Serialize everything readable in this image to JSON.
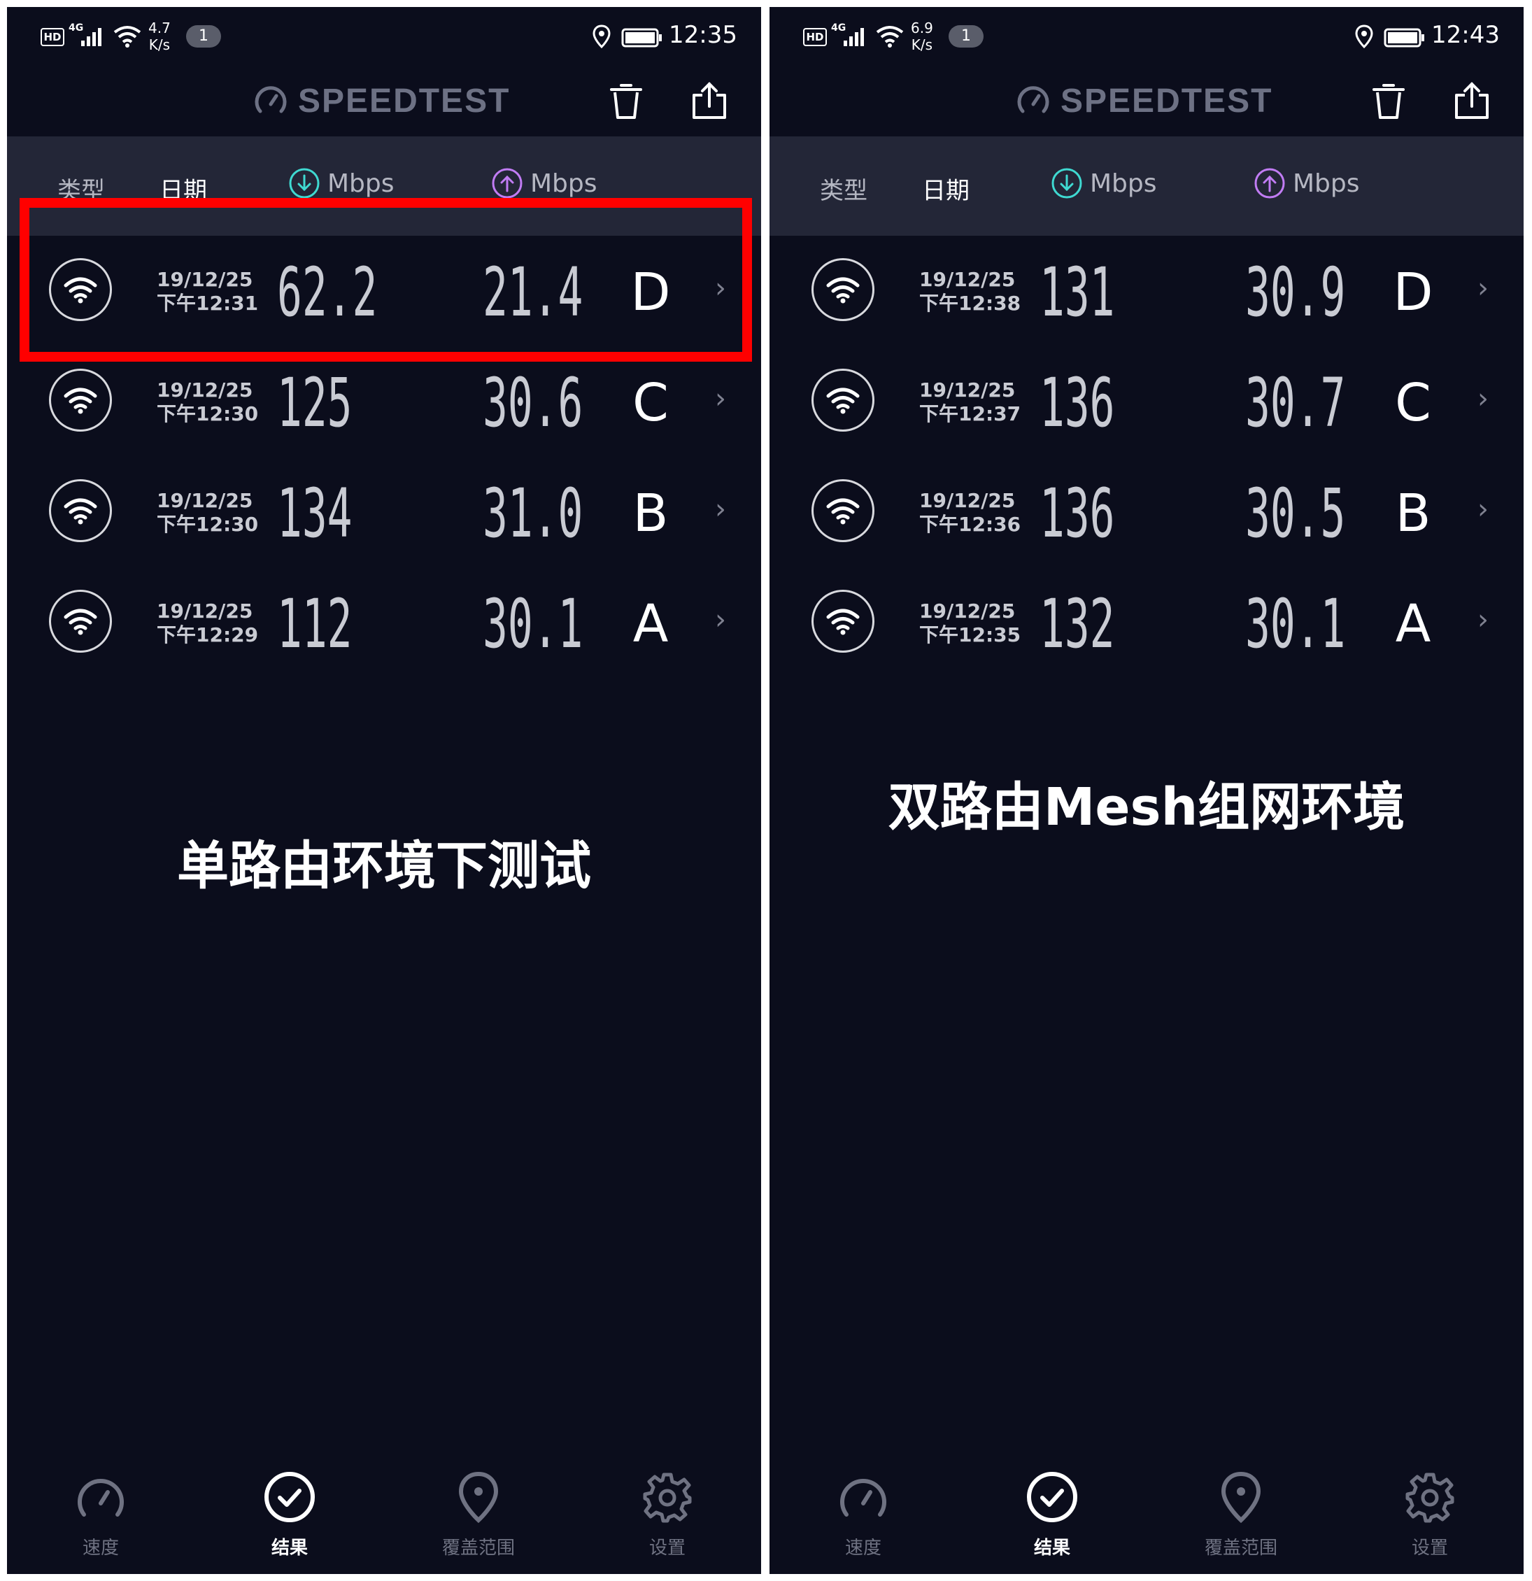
{
  "screens": [
    {
      "status": {
        "hd": "HD",
        "net": "4G",
        "speed_value": "4.7",
        "speed_unit": "K/s",
        "badge": "1",
        "time": "12:35"
      },
      "app": {
        "brand": "SPEEDTEST"
      },
      "header": {
        "type": "类型",
        "date": "日期",
        "down_unit": "Mbps",
        "up_unit": "Mbps"
      },
      "rows": [
        {
          "date": "19/12/25",
          "time": "下午12:31",
          "download": "62.2",
          "upload": "21.4",
          "label": "D"
        },
        {
          "date": "19/12/25",
          "time": "下午12:30",
          "download": "125",
          "upload": "30.6",
          "label": "C"
        },
        {
          "date": "19/12/25",
          "time": "下午12:30",
          "download": "134",
          "upload": "31.0",
          "label": "B"
        },
        {
          "date": "19/12/25",
          "time": "下午12:29",
          "download": "112",
          "upload": "30.1",
          "label": "A"
        }
      ],
      "caption": "单路由环境下测试",
      "nav": {
        "speed": "速度",
        "results": "结果",
        "coverage": "覆盖范围",
        "settings": "设置"
      }
    },
    {
      "status": {
        "hd": "HD",
        "net": "4G",
        "speed_value": "6.9",
        "speed_unit": "K/s",
        "badge": "1",
        "time": "12:43"
      },
      "app": {
        "brand": "SPEEDTEST"
      },
      "header": {
        "type": "类型",
        "date": "日期",
        "down_unit": "Mbps",
        "up_unit": "Mbps"
      },
      "rows": [
        {
          "date": "19/12/25",
          "time": "下午12:38",
          "download": "131",
          "upload": "30.9",
          "label": "D"
        },
        {
          "date": "19/12/25",
          "time": "下午12:37",
          "download": "136",
          "upload": "30.7",
          "label": "C"
        },
        {
          "date": "19/12/25",
          "time": "下午12:36",
          "download": "136",
          "upload": "30.5",
          "label": "B"
        },
        {
          "date": "19/12/25",
          "time": "下午12:35",
          "download": "132",
          "upload": "30.1",
          "label": "A"
        }
      ],
      "caption": "双路由Mesh组网环境",
      "nav": {
        "speed": "速度",
        "results": "结果",
        "coverage": "覆盖范围",
        "settings": "设置"
      }
    }
  ],
  "colors": {
    "background": "#0b0d1c",
    "header": "#232637",
    "download_accent": "#3fd9d1",
    "upload_accent": "#c17cf4",
    "highlight": "#ff0000"
  },
  "icons": [
    "wifi-icon",
    "trash-icon",
    "share-icon",
    "speedometer-icon",
    "check-circle-icon",
    "location-pin-icon",
    "gear-icon",
    "arrow-down-circle-icon",
    "arrow-up-circle-icon",
    "chevron-right-icon"
  ]
}
